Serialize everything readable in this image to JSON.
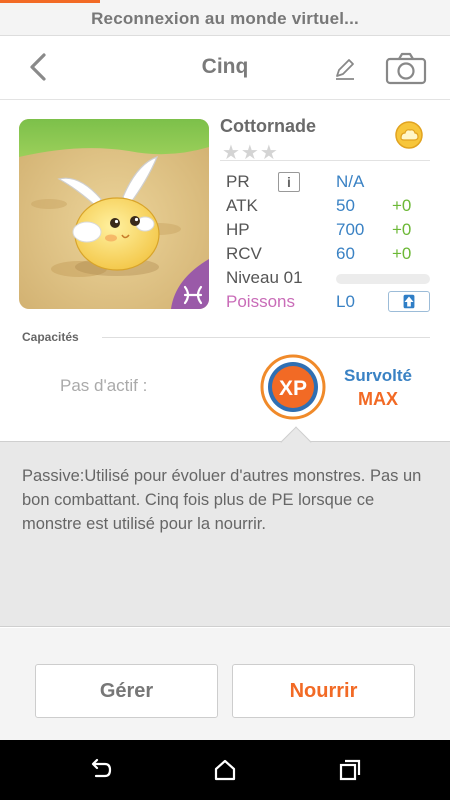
{
  "banner": {
    "text": "Reconnexion au monde virtuel..."
  },
  "header": {
    "title": "Cinq",
    "back_icon": "chevron-left-icon",
    "edit_icon": "pencil-icon",
    "camera_icon": "camera-icon"
  },
  "monster": {
    "name": "Cottornade",
    "stars": "★★★",
    "element_icon": "cloud-orb-icon",
    "attribute_icon": "pisces-icon",
    "stats": {
      "pr_label": "PR",
      "pr_info": "i",
      "pr_value": "N/A",
      "atk_label": "ATK",
      "atk_value": "50",
      "atk_bonus": "+0",
      "hp_label": "HP",
      "hp_value": "700",
      "hp_bonus": "+0",
      "rcv_label": "RCV",
      "rcv_value": "60",
      "rcv_bonus": "+0",
      "level_label": "Niveau 01",
      "level_progress": 0,
      "sign_label": "Poissons",
      "sign_value": "L0",
      "upgrade_icon": "arrow-up-icon"
    }
  },
  "abilities": {
    "section_label": "Capacités",
    "active_label": "Pas d'actif :",
    "badge_text": "XP",
    "skill_name": "Survolté",
    "skill_level": "MAX",
    "description": "Passive:Utilisé pour évoluer d'autres monstres. Pas un bon combattant. Cinq fois plus de PE lorsque ce monstre est utilisé pour la nourrir."
  },
  "actions": {
    "manage_label": "Gérer",
    "feed_label": "Nourrir"
  },
  "system_nav": {
    "back_icon": "android-back-icon",
    "home_icon": "android-home-icon",
    "recents_icon": "android-recents-icon"
  },
  "colors": {
    "accent": "#f26a25",
    "stat_value": "#3a82c4",
    "bonus": "#6cb836",
    "sign": "#c96cb8"
  }
}
